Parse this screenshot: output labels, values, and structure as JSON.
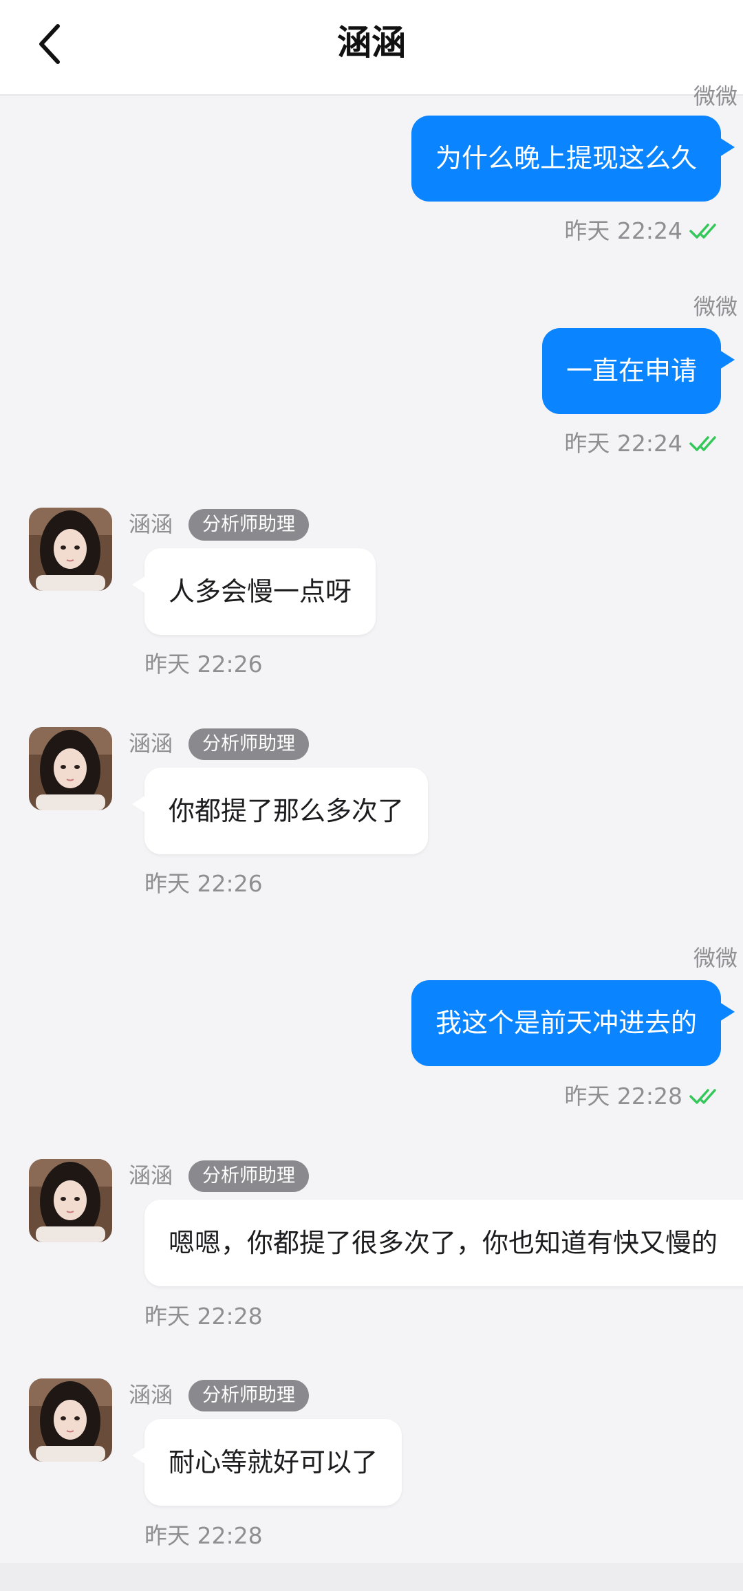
{
  "header": {
    "title": "涵涵",
    "back_icon": "chevron-left-icon"
  },
  "colors": {
    "outgoing_bubble": "#0a84ff",
    "incoming_bubble": "#ffffff",
    "badge": "#8a8a8e",
    "read_check": "#34c759",
    "background": "#f4f4f6"
  },
  "messages": [
    {
      "direction": "out",
      "sender": "微微",
      "text": "为什么晚上提现这么久",
      "time": "昨天 22:24",
      "read": true
    },
    {
      "direction": "out",
      "sender": "微微",
      "text": "一直在申请",
      "time": "昨天 22:24",
      "read": true
    },
    {
      "direction": "in",
      "sender": "涵涵",
      "badge": "分析师助理",
      "text": "人多会慢一点呀",
      "time": "昨天 22:26"
    },
    {
      "direction": "in",
      "sender": "涵涵",
      "badge": "分析师助理",
      "text": "你都提了那么多次了",
      "time": "昨天 22:26"
    },
    {
      "direction": "out",
      "sender": "微微",
      "text": "我这个是前天冲进去的",
      "time": "昨天 22:28",
      "read": true
    },
    {
      "direction": "in",
      "sender": "涵涵",
      "badge": "分析师助理",
      "text": "嗯嗯，你都提了很多次了，你也知道有快又慢的",
      "time": "昨天 22:28"
    },
    {
      "direction": "in",
      "sender": "涵涵",
      "badge": "分析师助理",
      "text": "耐心等就好可以了",
      "time": "昨天 22:28"
    }
  ]
}
